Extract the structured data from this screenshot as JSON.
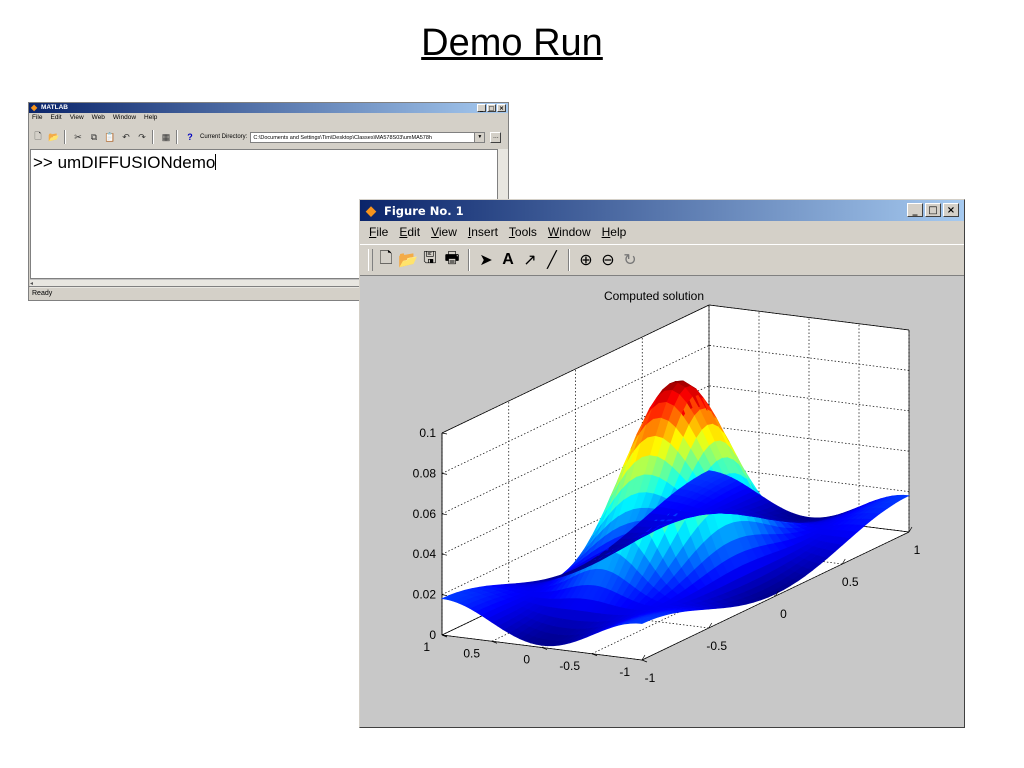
{
  "slide": {
    "title": "Demo Run"
  },
  "matlab_window": {
    "title": "MATLAB",
    "menu": [
      "File",
      "Edit",
      "View",
      "Web",
      "Window",
      "Help"
    ],
    "current_directory_label": "Current Directory:",
    "current_directory": "C:\\Documents and Settings\\Tim\\Desktop\\Classes\\MA578S03\\umMA578h",
    "command": ">> umDIFFUSIONdemo",
    "status": "Ready"
  },
  "figure_window": {
    "title": "Figure No. 1",
    "menu": [
      "File",
      "Edit",
      "View",
      "Insert",
      "Tools",
      "Window",
      "Help"
    ]
  },
  "window_buttons": {
    "minimize": "_",
    "maximize": "□",
    "close": "×"
  },
  "chart_data": {
    "type": "surface",
    "title": "Computed solution",
    "xlabel": "",
    "ylabel": "",
    "zlabel": "",
    "xlim": [
      -1,
      1
    ],
    "ylim": [
      -1,
      1
    ],
    "zlim": [
      0,
      0.1
    ],
    "x_ticks": [
      "-1",
      "-0.5",
      "0",
      "0.5",
      "1"
    ],
    "y_ticks": [
      "-1",
      "-0.5",
      "0",
      "0.5",
      "1"
    ],
    "z_ticks": [
      "0",
      "0.02",
      "0.04",
      "0.06",
      "0.08",
      "0.1"
    ],
    "peak": {
      "x": 0,
      "y": 0,
      "z": 0.1
    },
    "colormap": "jet",
    "grid": true
  }
}
